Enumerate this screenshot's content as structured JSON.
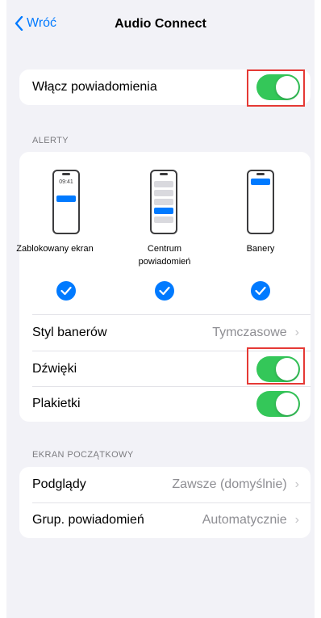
{
  "nav": {
    "back_label": "Wróć",
    "title": "Audio Connect"
  },
  "notifications": {
    "label": "Włącz powiadomienia",
    "enabled": true
  },
  "alerts": {
    "header": "ALERTY",
    "styles": [
      {
        "label": "Zablokowany ekran",
        "checked": true
      },
      {
        "label": "Centrum powiadomień",
        "checked": true
      },
      {
        "label": "Banery",
        "checked": true
      }
    ],
    "lock_screen_time": "09:41",
    "banner_style_label": "Styl banerów",
    "banner_style_value": "Tymczasowe",
    "sounds_label": "Dźwięki",
    "sounds_enabled": true,
    "badges_label": "Plakietki",
    "badges_enabled": true
  },
  "home_screen": {
    "header": "EKRAN POCZĄTKOWY",
    "previews_label": "Podglądy",
    "previews_value": "Zawsze (domyślnie)",
    "grouping_label": "Grup. powiadomień",
    "grouping_value": "Automatycznie"
  },
  "colors": {
    "accent": "#007aff",
    "toggle_on": "#34c759",
    "highlight": "#e53935",
    "background": "#f2f2f7"
  }
}
